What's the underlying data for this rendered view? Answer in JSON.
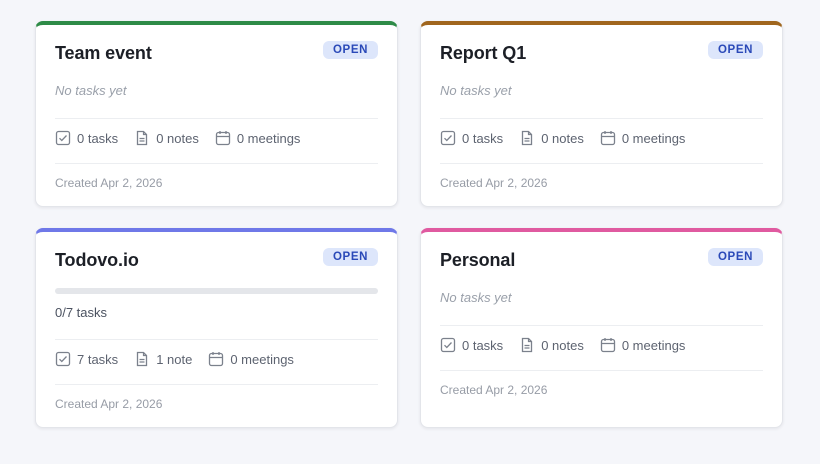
{
  "colors": {
    "team_event_accent": "#2e8b47",
    "report_q1_accent": "#a0661e",
    "todovo_accent": "#6f78e8",
    "personal_accent": "#e05aa0",
    "badge_bg": "#dde6fb",
    "badge_text": "#2a49b8"
  },
  "cards": [
    {
      "title": "Team event",
      "status": "OPEN",
      "empty_text": "No tasks yet",
      "tasks": "0 tasks",
      "notes": "0 notes",
      "meetings": "0 meetings",
      "created": "Created Apr 2, 2026"
    },
    {
      "title": "Report Q1",
      "status": "OPEN",
      "empty_text": "No tasks yet",
      "tasks": "0 tasks",
      "notes": "0 notes",
      "meetings": "0 meetings",
      "created": "Created Apr 2, 2026"
    },
    {
      "title": "Todovo.io",
      "status": "OPEN",
      "progress_label": "0/7 tasks",
      "progress_fraction": 0,
      "tasks": "7 tasks",
      "notes": "1 note",
      "meetings": "0 meetings",
      "created": "Created Apr 2, 2026"
    },
    {
      "title": "Personal",
      "status": "OPEN",
      "empty_text": "No tasks yet",
      "tasks": "0 tasks",
      "notes": "0 notes",
      "meetings": "0 meetings",
      "created": "Created Apr 2, 2026"
    }
  ],
  "icons": {
    "tasks": "checkbox-icon",
    "notes": "document-icon",
    "meetings": "calendar-icon"
  }
}
